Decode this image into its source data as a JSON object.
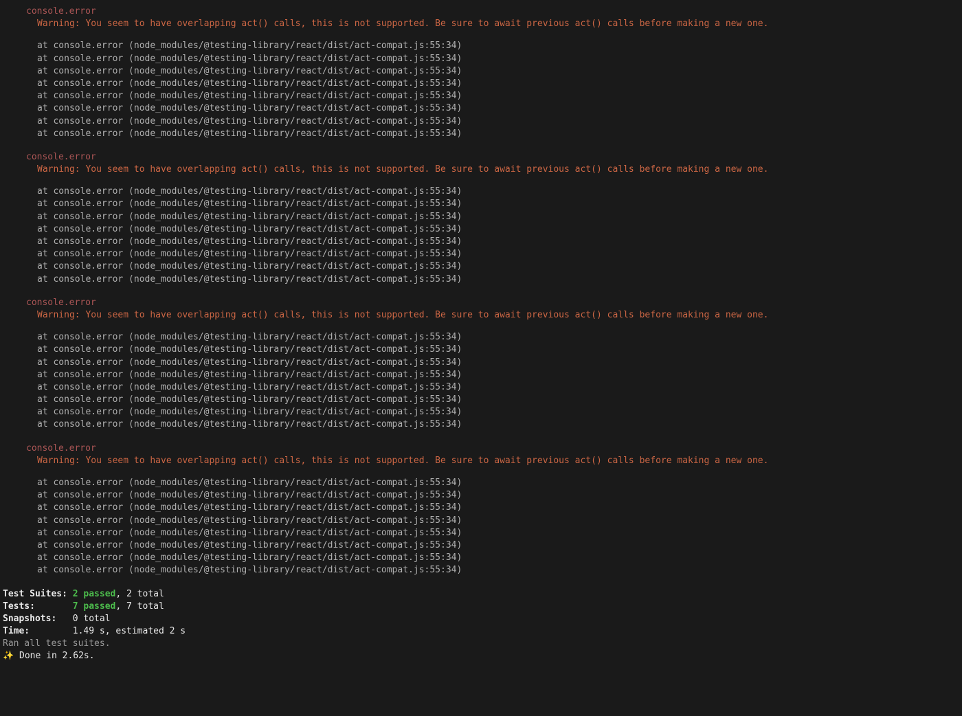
{
  "errors": {
    "header": "console.error",
    "warning": "Warning: You seem to have overlapping act() calls, this is not supported. Be sure to await previous act() calls before making a new one.",
    "stackLine": "at console.error (node_modules/@testing-library/react/dist/act-compat.js:55:34)",
    "stackRepeat": 8,
    "blockCount": 4
  },
  "summary": {
    "testSuites": {
      "label": "Test Suites: ",
      "passed": "2 passed",
      "rest": ", 2 total"
    },
    "tests": {
      "label": "Tests:       ",
      "passed": "7 passed",
      "rest": ", 7 total"
    },
    "snapshots": {
      "label": "Snapshots:   ",
      "value": "0 total"
    },
    "time": {
      "label": "Time:        ",
      "value": "1.49 s, estimated 2 s"
    },
    "ran": "Ran all test suites.",
    "sparkle": "✨",
    "done": "  Done in 2.62s."
  }
}
